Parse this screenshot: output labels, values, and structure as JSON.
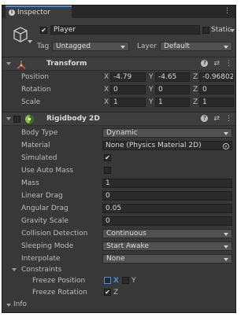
{
  "tab": {
    "label": "Inspector"
  },
  "header": {
    "object_name": "Player",
    "active": true,
    "static_label": "Static",
    "tag_label": "Tag",
    "tag_value": "Untagged",
    "layer_label": "Layer",
    "layer_value": "Default"
  },
  "transform": {
    "title": "Transform",
    "position": {
      "label": "Position",
      "x": "-4.79",
      "y": "-4.65",
      "z": "-0.96802"
    },
    "rotation": {
      "label": "Rotation",
      "x": "0",
      "y": "0",
      "z": "0"
    },
    "scale": {
      "label": "Scale",
      "x": "1",
      "y": "1",
      "z": "1"
    },
    "axes": [
      "X",
      "Y",
      "Z"
    ]
  },
  "rigidbody": {
    "title": "Rigidbody 2D",
    "body_type": {
      "label": "Body Type",
      "value": "Dynamic"
    },
    "material": {
      "label": "Material",
      "value": "None (Physics Material 2D)"
    },
    "simulated": {
      "label": "Simulated",
      "checked": true
    },
    "use_auto_mass": {
      "label": "Use Auto Mass",
      "checked": false
    },
    "mass": {
      "label": "Mass",
      "value": "1"
    },
    "linear_drag": {
      "label": "Linear Drag",
      "value": "0"
    },
    "angular_drag": {
      "label": "Angular Drag",
      "value": "0.05"
    },
    "gravity_scale": {
      "label": "Gravity Scale",
      "value": "0"
    },
    "collision_detection": {
      "label": "Collision Detection",
      "value": "Continuous"
    },
    "sleeping_mode": {
      "label": "Sleeping Mode",
      "value": "Start Awake"
    },
    "interpolate": {
      "label": "Interpolate",
      "value": "None"
    },
    "constraints": {
      "label": "Constraints",
      "freeze_position": {
        "label": "Freeze Position",
        "x_label": "X",
        "y_label": "Y",
        "x": false,
        "y": false
      },
      "freeze_rotation": {
        "label": "Freeze Rotation",
        "z_label": "Z",
        "z": true
      }
    },
    "info": {
      "label": "Info"
    }
  },
  "colors": {
    "accent": "#4a8cd8",
    "panel": "#383838",
    "field": "#2a2a2a",
    "transform_icon": "#e05050",
    "rigidbody_icon": "#8cc63f"
  }
}
